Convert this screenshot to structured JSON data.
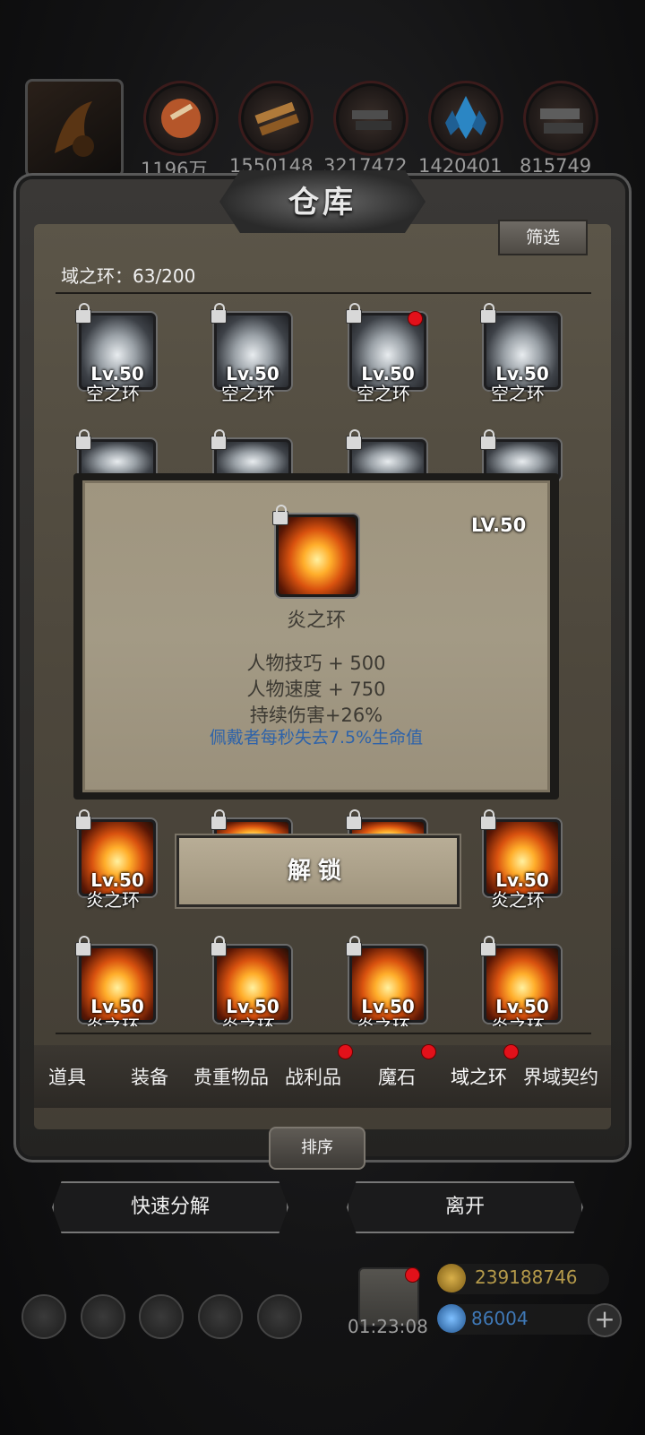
{
  "resources": [
    {
      "icon": "horn-icon",
      "count": ""
    },
    {
      "icon": "meat-icon",
      "count": "1196万"
    },
    {
      "icon": "wood-icon",
      "count": "1550148"
    },
    {
      "icon": "iron-ingot-icon",
      "count": "3217472"
    },
    {
      "icon": "crystal-icon",
      "count": "1420401"
    },
    {
      "icon": "steel-icon",
      "count": "815749"
    }
  ],
  "warehouse": {
    "title": "仓库",
    "filter_label": "筛选",
    "count_label": "域之环：63/200"
  },
  "grid": {
    "row1": [
      {
        "level": "Lv.50",
        "name": "空之环",
        "type": "sky",
        "new": false
      },
      {
        "level": "Lv.50",
        "name": "空之环",
        "type": "sky",
        "new": false
      },
      {
        "level": "Lv.50",
        "name": "空之环",
        "type": "sky",
        "new": true
      },
      {
        "level": "Lv.50",
        "name": "空之环",
        "type": "sky",
        "new": false
      }
    ],
    "row3": [
      {
        "level": "Lv.50",
        "name": "炎之环",
        "type": "fire"
      },
      {
        "level": "Lv.50",
        "name": "炎之环",
        "type": "fire"
      }
    ],
    "row4": [
      {
        "level": "Lv.50",
        "name": "炎之环",
        "type": "fire"
      },
      {
        "level": "Lv.50",
        "name": "炎之环",
        "type": "fire"
      },
      {
        "level": "Lv.50",
        "name": "炎之环",
        "type": "fire"
      },
      {
        "level": "Lv.50",
        "name": "炎之环",
        "type": "fire"
      }
    ]
  },
  "tooltip": {
    "level": "LV.50",
    "name": "炎之环",
    "stats": [
      "人物技巧 + 500",
      "人物速度 + 750",
      "持续伤害+26%"
    ],
    "description": "佩戴者每秒失去7.5%生命值",
    "description_color": "#2e63a9"
  },
  "unlock_label": "解锁",
  "tabs": [
    {
      "label": "道具",
      "badge": false
    },
    {
      "label": "装备",
      "badge": false
    },
    {
      "label": "贵重物品",
      "badge": false
    },
    {
      "label": "战利品",
      "badge": true
    },
    {
      "label": "魔石",
      "badge": true
    },
    {
      "label": "域之环",
      "badge": true,
      "active": true
    },
    {
      "label": "界域契约",
      "badge": false
    }
  ],
  "sort_label": "排序",
  "buttons": {
    "quick_decompose": "快速分解",
    "leave": "离开"
  },
  "hud": {
    "timer": "01:23:08",
    "gold": "239188746",
    "gems": "86004",
    "gold_color": "#b59a4a",
    "gem_color": "#3f78b6"
  }
}
